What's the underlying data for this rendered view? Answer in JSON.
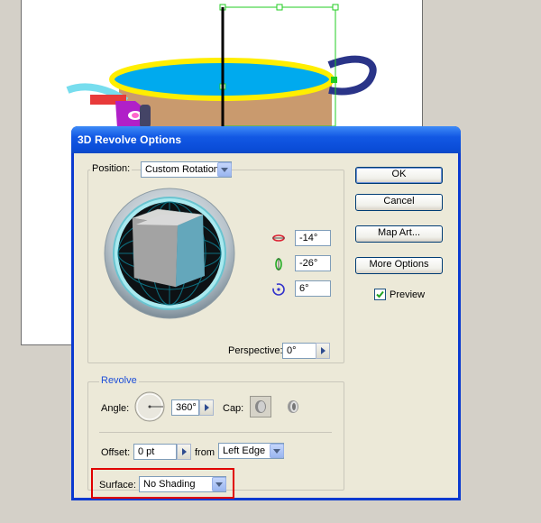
{
  "dialog": {
    "title": "3D Revolve Options",
    "position_group": {
      "label": "Position:",
      "preset": "Custom Rotation",
      "rotation_x": "-14°",
      "rotation_y": "-26°",
      "rotation_z": "6°",
      "perspective_label": "Perspective:",
      "perspective_value": "0°"
    },
    "revolve_group": {
      "label": "Revolve",
      "angle_label": "Angle:",
      "angle_value": "360°",
      "cap_label": "Cap:",
      "offset_label": "Offset:",
      "offset_value": "0 pt",
      "from_label": "from",
      "from_value": "Left Edge"
    },
    "surface": {
      "label": "Surface:",
      "value": "No Shading"
    },
    "buttons": {
      "ok": "OK",
      "cancel": "Cancel",
      "map_art": "Map Art...",
      "more_options": "More Options"
    },
    "preview": {
      "label": "Preview",
      "checked": true
    }
  },
  "colors": {
    "highlight": "#e00000",
    "cup_rim": "#ffee00",
    "cup_fill": "#00aaee",
    "cup_body": "#c99a6e",
    "handle": "#2a3488",
    "selection": "#22cc22"
  }
}
